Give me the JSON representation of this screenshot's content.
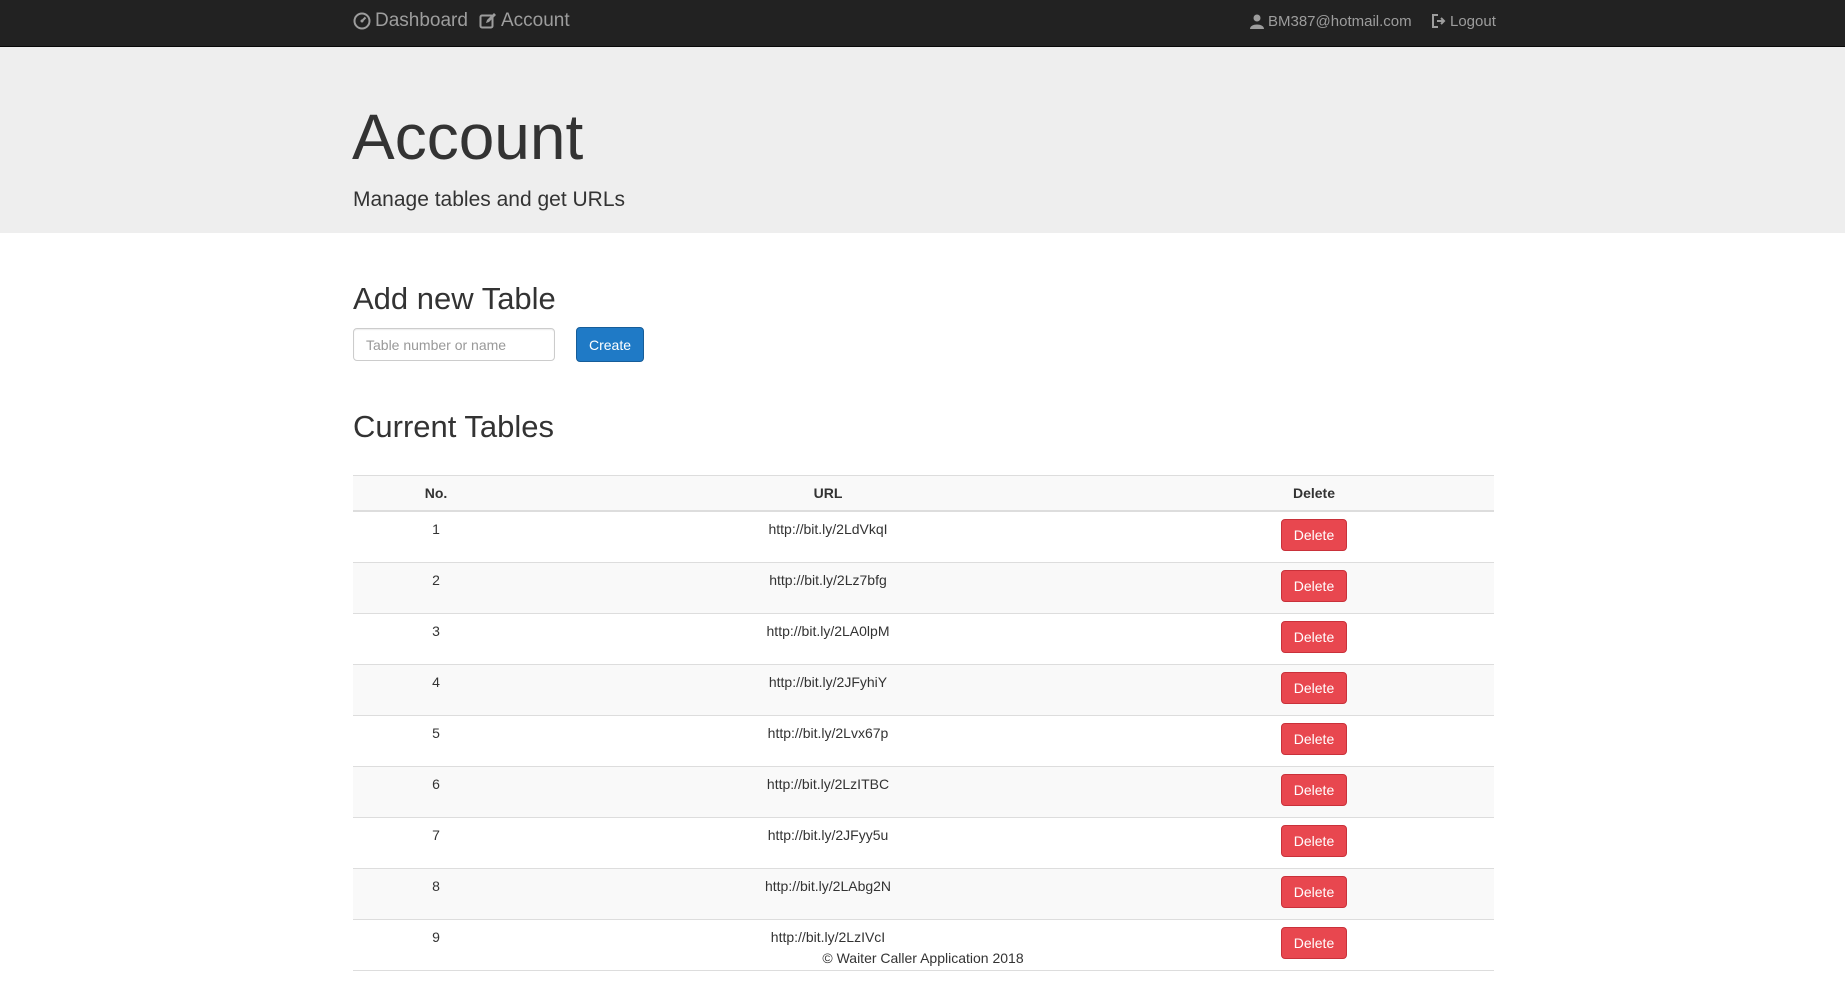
{
  "nav": {
    "dashboard_label": "Dashboard",
    "account_label": "Account",
    "user_email": "BM387@hotmail.com",
    "logout_label": "Logout",
    "icons": {
      "dashboard": "dashboard-gauge-icon",
      "account": "edit-icon",
      "user": "user-icon",
      "logout": "logout-icon"
    }
  },
  "header": {
    "title": "Account",
    "subtitle": "Manage tables and get URLs"
  },
  "add_table": {
    "heading": "Add new Table",
    "input_value": "",
    "placeholder": "Table number or name",
    "create_label": "Create"
  },
  "current_tables": {
    "heading": "Current Tables",
    "columns": [
      "No.",
      "URL",
      "Delete"
    ],
    "rows": [
      {
        "no": "1",
        "url": "http://bit.ly/2LdVkqI",
        "action": "Delete"
      },
      {
        "no": "2",
        "url": "http://bit.ly/2Lz7bfg",
        "action": "Delete"
      },
      {
        "no": "3",
        "url": "http://bit.ly/2LA0lpM",
        "action": "Delete"
      },
      {
        "no": "4",
        "url": "http://bit.ly/2JFyhiY",
        "action": "Delete"
      },
      {
        "no": "5",
        "url": "http://bit.ly/2Lvx67p",
        "action": "Delete"
      },
      {
        "no": "6",
        "url": "http://bit.ly/2LzITBC",
        "action": "Delete"
      },
      {
        "no": "7",
        "url": "http://bit.ly/2JFyy5u",
        "action": "Delete"
      },
      {
        "no": "8",
        "url": "http://bit.ly/2LAbg2N",
        "action": "Delete"
      },
      {
        "no": "9",
        "url": "http://bit.ly/2LzIVcI",
        "action": "Delete"
      }
    ]
  },
  "footer": {
    "text": "© Waiter Caller Application 2018"
  },
  "colors": {
    "navbar": "#222222",
    "jumbotron": "#eeeeee",
    "primary": "#1f7ac6",
    "danger": "#e8474f"
  }
}
